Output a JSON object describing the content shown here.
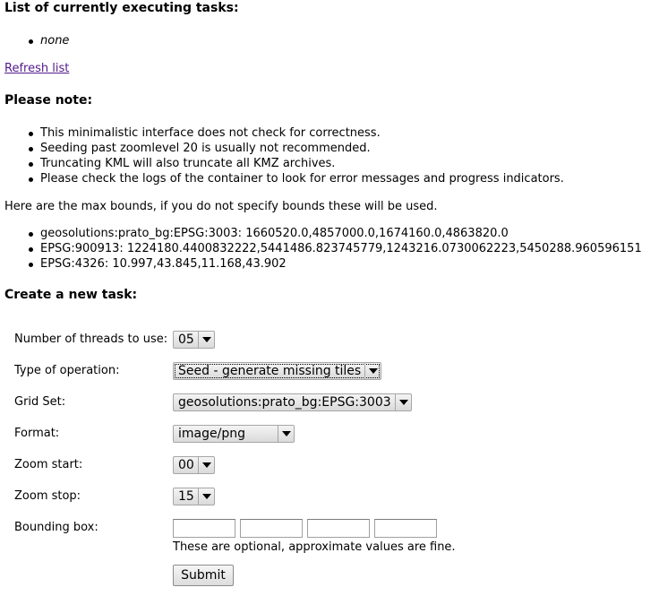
{
  "executing": {
    "heading": "List of currently executing tasks:",
    "items": [
      "none"
    ],
    "refresh_link": "Refresh list"
  },
  "notes": {
    "heading": "Please note:",
    "items": [
      "This minimalistic interface does not check for correctness.",
      "Seeding past zoomlevel 20 is usually not recommended.",
      "Truncating KML will also truncate all KMZ archives.",
      "Please check the logs of the container to look for error messages and progress indicators."
    ]
  },
  "bounds": {
    "intro": "Here are the max bounds, if you do not specify bounds these will be used.",
    "items": [
      "geosolutions:prato_bg:EPSG:3003: 1660520.0,4857000.0,1674160.0,4863820.0",
      "EPSG:900913: 1224180.4400832222,5441486.823745779,1243216.0730062223,5450288.960596151",
      "EPSG:4326: 10.997,43.845,11.168,43.902"
    ]
  },
  "form": {
    "heading": "Create a new task:",
    "threads": {
      "label": "Number of threads to use:",
      "value": "05"
    },
    "operation": {
      "label": "Type of operation:",
      "value": "Seed - generate missing tiles"
    },
    "gridset": {
      "label": "Grid Set:",
      "value": "geosolutions:prato_bg:EPSG:3003"
    },
    "format": {
      "label": "Format:",
      "value": "image/png"
    },
    "zoom_start": {
      "label": "Zoom start:",
      "value": "00"
    },
    "zoom_stop": {
      "label": "Zoom stop:",
      "value": "15"
    },
    "bbox": {
      "label": "Bounding box:",
      "values": [
        "",
        "",
        "",
        ""
      ],
      "hint": "These are optional, approximate values are fine."
    },
    "submit_label": "Submit"
  }
}
